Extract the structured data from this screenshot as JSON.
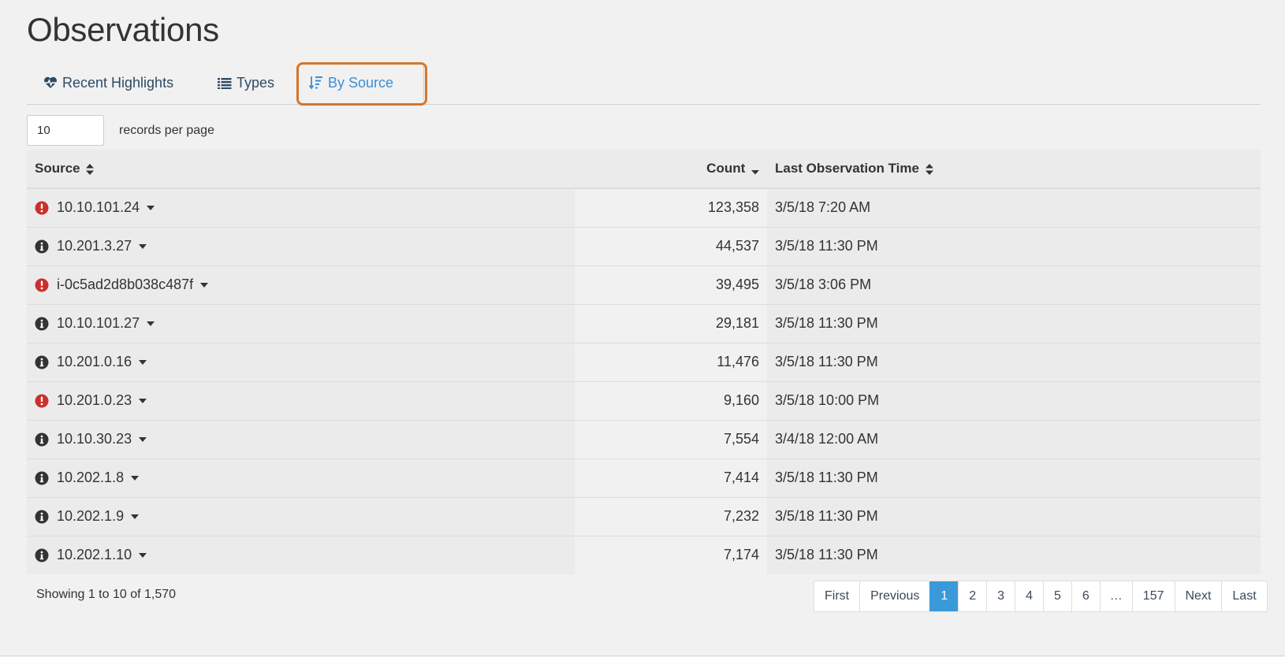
{
  "page": {
    "title": "Observations"
  },
  "tabs": [
    {
      "label": "Recent Highlights",
      "icon": "heartbeat-icon"
    },
    {
      "label": "Types",
      "icon": "list-icon"
    },
    {
      "label": "By Source",
      "icon": "sort-amount-icon",
      "active": true
    }
  ],
  "records_per_page": {
    "value": "10",
    "label": "records per page"
  },
  "table": {
    "headers": {
      "source": "Source",
      "count": "Count",
      "time": "Last Observation Time"
    },
    "rows": [
      {
        "source": "10.10.101.24",
        "count": "123,358",
        "time": "3/5/18 7:20 AM",
        "status": "alert"
      },
      {
        "source": "10.201.3.27",
        "count": "44,537",
        "time": "3/5/18 11:30 PM",
        "status": "info"
      },
      {
        "source": "i-0c5ad2d8b038c487f",
        "count": "39,495",
        "time": "3/5/18 3:06 PM",
        "status": "alert"
      },
      {
        "source": "10.10.101.27",
        "count": "29,181",
        "time": "3/5/18 11:30 PM",
        "status": "info"
      },
      {
        "source": "10.201.0.16",
        "count": "11,476",
        "time": "3/5/18 11:30 PM",
        "status": "info"
      },
      {
        "source": "10.201.0.23",
        "count": "9,160",
        "time": "3/5/18 10:00 PM",
        "status": "alert"
      },
      {
        "source": "10.10.30.23",
        "count": "7,554",
        "time": "3/4/18 12:00 AM",
        "status": "info"
      },
      {
        "source": "10.202.1.8",
        "count": "7,414",
        "time": "3/5/18 11:30 PM",
        "status": "info"
      },
      {
        "source": "10.202.1.9",
        "count": "7,232",
        "time": "3/5/18 11:30 PM",
        "status": "info"
      },
      {
        "source": "10.202.1.10",
        "count": "7,174",
        "time": "3/5/18 11:30 PM",
        "status": "info"
      }
    ]
  },
  "footer": {
    "showing": "Showing 1 to 10 of 1,570"
  },
  "pagination": {
    "items": [
      "First",
      "Previous",
      "1",
      "2",
      "3",
      "4",
      "5",
      "6",
      "…",
      "157",
      "Next",
      "Last"
    ],
    "active": "1"
  },
  "colors": {
    "alert": "#c9302c",
    "info": "#333333",
    "accent": "#3a9ad9",
    "highlight": "#d4762a"
  }
}
